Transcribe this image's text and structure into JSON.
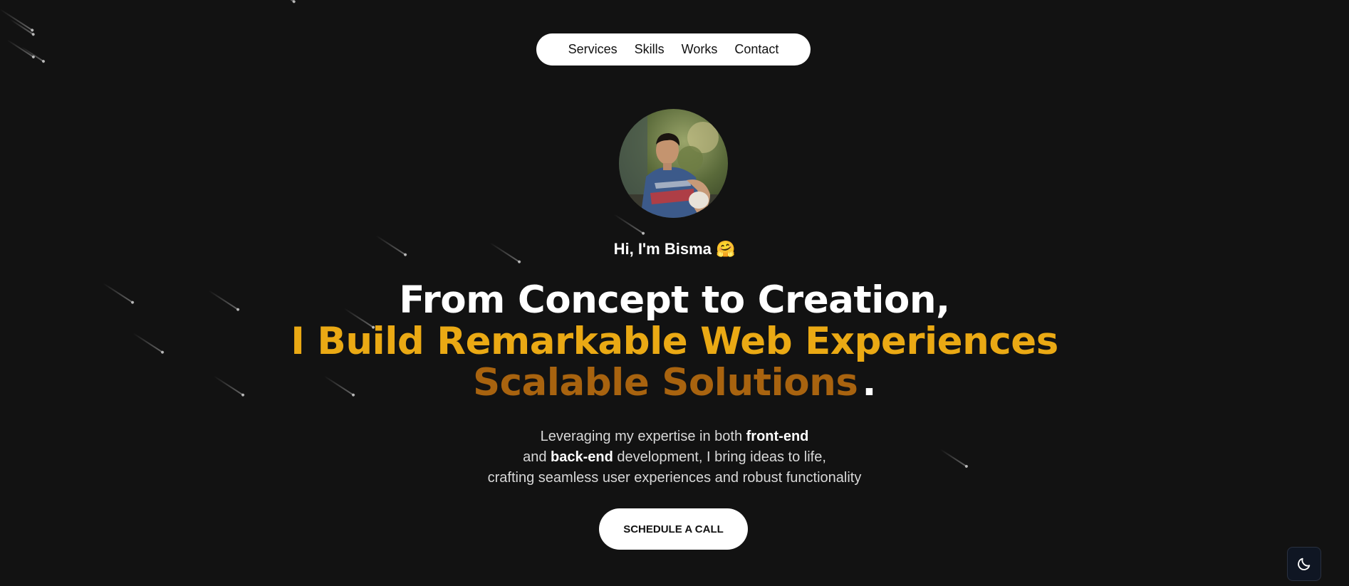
{
  "nav": {
    "items": [
      {
        "label": "Services"
      },
      {
        "label": "Skills"
      },
      {
        "label": "Works"
      },
      {
        "label": "Contact"
      }
    ]
  },
  "hero": {
    "greeting": "Hi, I'm Bisma",
    "greeting_emoji": "🤗",
    "headline_line1": "From Concept to Creation,",
    "headline_line2": "I Build Remarkable Web Experiences",
    "headline_line3": "Scalable Solutions",
    "headline_dot": ".",
    "desc_line1_pre": "Leveraging my expertise in both ",
    "desc_line1_bold": "front-end",
    "desc_line2_pre": "and ",
    "desc_line2_bold": "back-end",
    "desc_line2_post": " development, I bring ideas to life,",
    "desc_line3": "crafting seamless user experiences and robust functionality",
    "cta_label": "SCHEDULE A CALL"
  },
  "colors": {
    "background": "#121212",
    "accent_primary": "#eaa914",
    "accent_secondary": "#a8630f"
  },
  "icons": {
    "theme_toggle": "moon-icon"
  }
}
